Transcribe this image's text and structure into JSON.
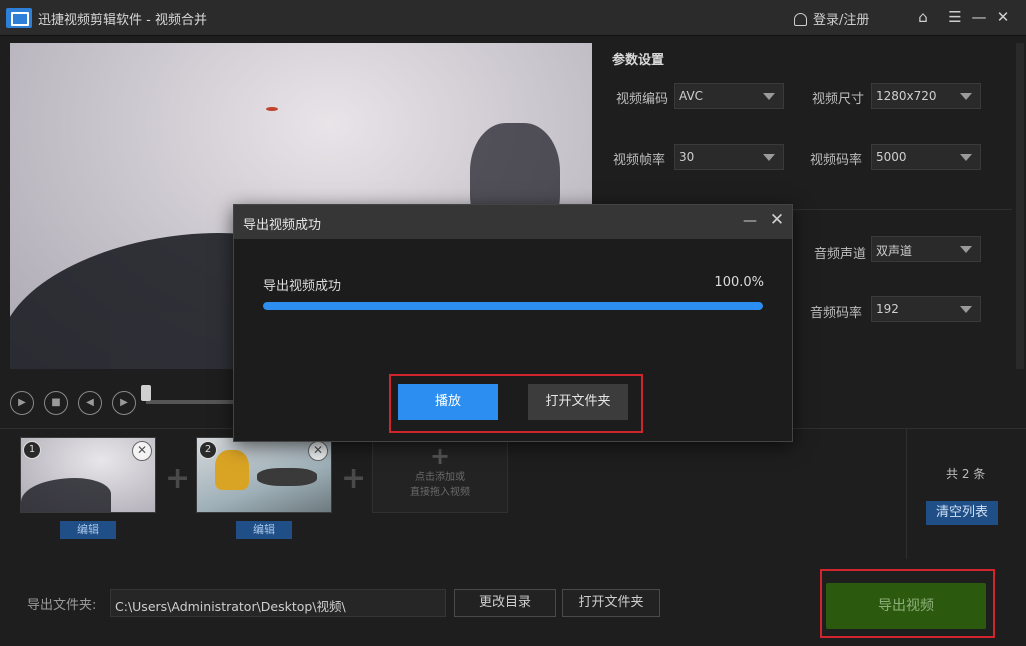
{
  "app": {
    "title": "迅捷视频剪辑软件 - 视频合并",
    "login_label": "登录/注册"
  },
  "settings": {
    "title": "参数设置",
    "video_codec": {
      "label": "视频编码",
      "value": "AVC"
    },
    "video_size": {
      "label": "视频尺寸",
      "value": "1280x720"
    },
    "frame_rate": {
      "label": "视频帧率",
      "value": "30"
    },
    "video_bitrate": {
      "label": "视频码率",
      "value": "5000"
    },
    "audio_channel": {
      "label": "音频声道",
      "value": "双声道"
    },
    "audio_bitrate": {
      "label": "音频码率",
      "value": "192"
    }
  },
  "clips": [
    {
      "index": "1",
      "edit_label": "编辑"
    },
    {
      "index": "2",
      "edit_label": "编辑"
    }
  ],
  "add_clip": {
    "line1": "点击添加或",
    "line2": "直接拖入视频"
  },
  "list": {
    "count_label": "共 2 条",
    "clear_label": "清空列表"
  },
  "output": {
    "folder_label": "导出文件夹:",
    "path": "C:\\Users\\Administrator\\Desktop\\视频\\",
    "change_dir_label": "更改目录",
    "open_folder_label": "打开文件夹",
    "export_label": "导出视频"
  },
  "dialog": {
    "title": "导出视频成功",
    "status": "导出视频成功",
    "progress_text": "100.0%",
    "progress": 1.0,
    "play_label": "播放",
    "open_folder_label": "打开文件夹"
  },
  "colors": {
    "accent": "#2b8ef0",
    "highlight": "#d0252c",
    "export": "#2b5a0f"
  }
}
